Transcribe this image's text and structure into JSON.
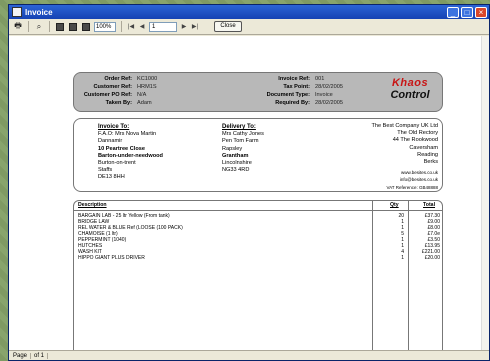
{
  "window": {
    "title": "Invoice"
  },
  "toolbar": {
    "zoom": "100%",
    "page": "1",
    "close_label": "Close"
  },
  "status": {
    "page_label": "Page",
    "page_count": "of 1"
  },
  "header": {
    "rows_left": [
      {
        "label": "Order Ref:",
        "value": "KC1000"
      },
      {
        "label": "Customer Ref:",
        "value": "HRM1S"
      },
      {
        "label": "Customer PO Ref:",
        "value": "N/A"
      },
      {
        "label": "Taken By:",
        "value": "Adam"
      }
    ],
    "rows_right": [
      {
        "label": "Invoice Ref:",
        "value": "001"
      },
      {
        "label": "Tax Point:",
        "value": "28/02/2005"
      },
      {
        "label": "Document Type:",
        "value": "Invoice"
      },
      {
        "label": "Required By:",
        "value": "28/02/2005"
      }
    ],
    "logo_line1": "Khaos",
    "logo_line2": "Control"
  },
  "invoice_to": {
    "heading": "Invoice To:",
    "lines": [
      "F.A.O: Mrs Nova Martin",
      "Dannamir",
      "10 Peartree Close",
      "Barton-under-needwood",
      "Burton-on-trent",
      "Staffs",
      "DE13 8HH"
    ]
  },
  "delivery_to": {
    "heading": "Delivery To:",
    "lines": [
      "Mrs Cathy Jones",
      "Pen Tom Farm",
      "Rapsley",
      "Grantham",
      "Lincolnshire",
      "NG33 4RD"
    ]
  },
  "company": {
    "lines": [
      "The Best Company UK Ltd",
      "The Old Rectory",
      "44 The Rookwood",
      "Caversham",
      "Reading",
      "Berks"
    ],
    "web": "www.besites.co.uk",
    "email": "info@besites.co.uk",
    "vat": "VAT Reference: GB48888"
  },
  "lines_table": {
    "headers": {
      "description": "Description",
      "qty": "Qty",
      "total": "Total"
    },
    "rows": [
      {
        "description": "BARGAIN LAB - 25 ltr Yellow (From tank)",
        "qty": "20",
        "total": "£37.30"
      },
      {
        "description": "BRIDGE LAW",
        "qty": "1",
        "total": "£9.00"
      },
      {
        "description": "REL WATER & BLUE Ref (LOOSE (100 PACK)",
        "qty": "1",
        "total": "£8.00"
      },
      {
        "description": "CHAMOISE (1 ltr)",
        "qty": "5",
        "total": "£7.0e"
      },
      {
        "description": "PEPPERMINT (1040)",
        "qty": "1",
        "total": "£3.50"
      },
      {
        "description": "HUTCHES",
        "qty": "1",
        "total": "£13.95"
      },
      {
        "description": "WASH KIT",
        "qty": "4",
        "total": "£221.00"
      },
      {
        "description": "HIPPO GIANT PLUS DRIVER",
        "qty": "1",
        "total": "£20.00"
      }
    ]
  },
  "colors": {
    "title_bar": "#1542b3",
    "logo_red": "#c81414",
    "header_grey": "#b8b8b8"
  }
}
